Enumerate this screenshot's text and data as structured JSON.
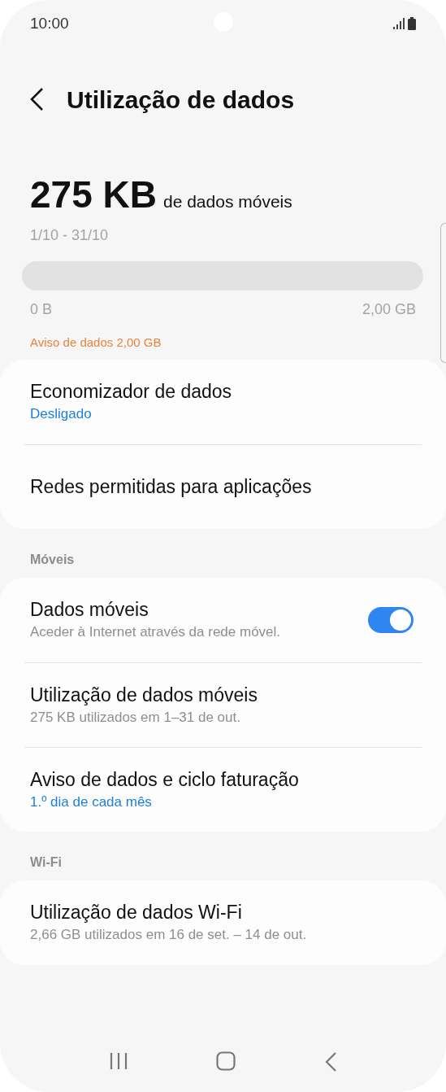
{
  "status_bar": {
    "time": "10:00"
  },
  "title": "Utilização de dados",
  "usage": {
    "amount": "275 KB",
    "caption": "de dados móveis",
    "period": "1/10 - 31/10",
    "level": 0,
    "scale_min": "0 B",
    "scale_max": "2,00 GB",
    "warning": "Aviso de dados 2,00 GB"
  },
  "groups": [
    {
      "items": [
        {
          "kind": "item",
          "title": "Economizador de dados",
          "subtitle": "Desligado",
          "color": "#1d7fd8"
        },
        {
          "kind": "item",
          "title": "Redes permitidas para aplicações"
        }
      ]
    },
    {
      "header": "Móveis",
      "items": [
        {
          "kind": "toggle",
          "title": "Dados móveis",
          "subtitle": "Aceder à Internet através da rede móvel.",
          "color": "#8e8e8e",
          "on": true
        },
        {
          "kind": "item",
          "title": "Utilização de dados móveis",
          "subtitle": "275 KB utilizados em 1–31 de out.",
          "color": "#8e8e8e"
        },
        {
          "kind": "item",
          "title": "Aviso de dados e ciclo faturação",
          "subtitle": "1.º dia de cada mês",
          "color": "#1d7fd8"
        }
      ]
    },
    {
      "header": "Wi-Fi",
      "items": [
        {
          "kind": "item",
          "title": "Utilização de dados Wi-Fi",
          "subtitle": "2,66 GB utilizados em 16 de set. – 14 de out.",
          "color": "#8e8e8e"
        }
      ]
    }
  ]
}
